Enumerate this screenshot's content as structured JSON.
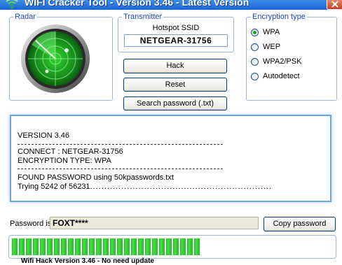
{
  "window": {
    "title": "WIFI Cracker Tool - Version 3.46 - Latest Version",
    "icon": "wifi-signal-icon",
    "title_bar_color": "#2a74e0"
  },
  "radar": {
    "legend": "Radar",
    "icon": "radar-icon"
  },
  "transmitter": {
    "legend": "Transmitter",
    "ssid_label": "Hotspot SSID",
    "ssid_value": "NETGEAR-31756"
  },
  "buttons": {
    "hack": "Hack",
    "reset": "Reset",
    "search": "Search password (.txt)",
    "copy": "Copy password"
  },
  "encryption": {
    "legend": "Encryption type",
    "options": [
      {
        "label": "WPA",
        "selected": true
      },
      {
        "label": "WEP",
        "selected": false
      },
      {
        "label": "WPA2/PSK",
        "selected": false
      },
      {
        "label": "Autodetect",
        "selected": false
      }
    ]
  },
  "log": {
    "version": "VERSION 3.46",
    "connect": "CONNECT : NETGEAR-31756",
    "encryption": "ENCRYPTION TYPE: WPA",
    "found": "FOUND PASSWORD using 50kpasswords.txt",
    "trying": "Trying 5242 of 56231"
  },
  "password": {
    "label": "Password is:",
    "value": "FOXT****"
  },
  "progress": {
    "fraction": 0.59,
    "color": "#2ec42e"
  },
  "footer": {
    "text": "Wifi Hack Version 3.46 - No need update"
  },
  "colors": {
    "legend": "#1b47c4",
    "radar_green": "#2fd02f",
    "log_border": "#6da6dc"
  }
}
